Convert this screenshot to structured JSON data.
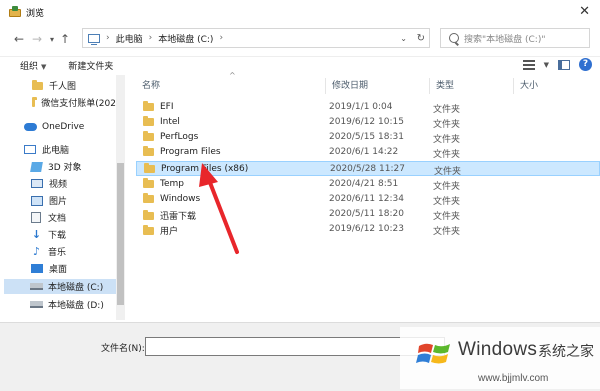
{
  "window": {
    "title": "浏览"
  },
  "address": {
    "crumbs": [
      "此电脑",
      "本地磁盘 (C:)"
    ],
    "search_placeholder": "搜索\"本地磁盘 (C:)\""
  },
  "toolbar": {
    "organize": "组织",
    "new_folder": "新建文件夹"
  },
  "nav": {
    "items": [
      {
        "label": "千人图",
        "icon": "folder-icon"
      },
      {
        "label": "微信支付账单(202",
        "icon": "folder-icon"
      },
      {
        "label": "OneDrive",
        "icon": "cloud-icon"
      },
      {
        "label": "此电脑",
        "icon": "computer-icon"
      },
      {
        "label": "3D 对象",
        "icon": "3d-objects-icon"
      },
      {
        "label": "视频",
        "icon": "video-icon"
      },
      {
        "label": "图片",
        "icon": "pictures-icon"
      },
      {
        "label": "文档",
        "icon": "document-icon"
      },
      {
        "label": "下载",
        "icon": "download-icon"
      },
      {
        "label": "音乐",
        "icon": "music-icon"
      },
      {
        "label": "桌面",
        "icon": "desktop-icon"
      },
      {
        "label": "本地磁盘 (C:)",
        "icon": "drive-icon",
        "selected": true
      },
      {
        "label": "本地磁盘 (D:)",
        "icon": "drive-icon"
      },
      {
        "label": "",
        "icon": "network-icon"
      }
    ]
  },
  "columns": {
    "name": "名称",
    "date": "修改日期",
    "type": "类型",
    "size": "大小"
  },
  "files": [
    {
      "name": "EFI",
      "date": "2019/1/1 0:04",
      "type": "文件夹"
    },
    {
      "name": "Intel",
      "date": "2019/6/12 10:15",
      "type": "文件夹"
    },
    {
      "name": "PerfLogs",
      "date": "2020/5/15 18:31",
      "type": "文件夹"
    },
    {
      "name": "Program Files",
      "date": "2020/6/1 14:22",
      "type": "文件夹"
    },
    {
      "name": "Program Files (x86)",
      "date": "2020/5/28 11:27",
      "type": "文件夹",
      "selected": true
    },
    {
      "name": "Temp",
      "date": "2020/4/21 8:51",
      "type": "文件夹"
    },
    {
      "name": "Windows",
      "date": "2020/6/11 12:34",
      "type": "文件夹"
    },
    {
      "name": "迅雷下载",
      "date": "2020/5/11 18:20",
      "type": "文件夹"
    },
    {
      "name": "用户",
      "date": "2019/6/12 10:23",
      "type": "文件夹"
    }
  ],
  "footer": {
    "filename_label": "文件名(N):",
    "filename_value": ""
  },
  "watermark": {
    "brand": "Windows",
    "cn": "系统之家",
    "url": "www.bjjmlv.com"
  },
  "colors": {
    "selection": "#cce8ff",
    "folder": "#e8bd52",
    "accent": "#2f6fd0",
    "arrow": "#e8262b"
  }
}
